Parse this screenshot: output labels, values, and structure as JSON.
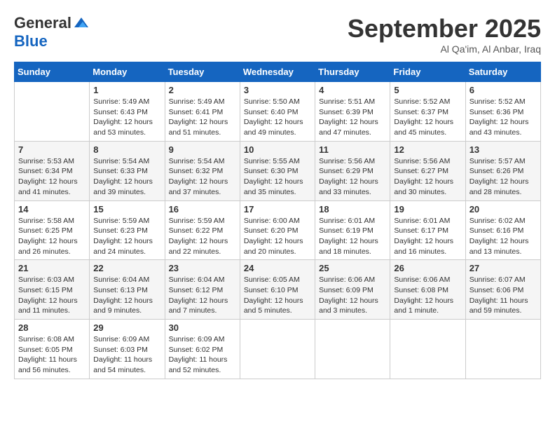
{
  "logo": {
    "general": "General",
    "blue": "Blue"
  },
  "title": "September 2025",
  "location": "Al Qa'im, Al Anbar, Iraq",
  "weekdays": [
    "Sunday",
    "Monday",
    "Tuesday",
    "Wednesday",
    "Thursday",
    "Friday",
    "Saturday"
  ],
  "weeks": [
    [
      {
        "day": "",
        "info": ""
      },
      {
        "day": "1",
        "info": "Sunrise: 5:49 AM\nSunset: 6:43 PM\nDaylight: 12 hours\nand 53 minutes."
      },
      {
        "day": "2",
        "info": "Sunrise: 5:49 AM\nSunset: 6:41 PM\nDaylight: 12 hours\nand 51 minutes."
      },
      {
        "day": "3",
        "info": "Sunrise: 5:50 AM\nSunset: 6:40 PM\nDaylight: 12 hours\nand 49 minutes."
      },
      {
        "day": "4",
        "info": "Sunrise: 5:51 AM\nSunset: 6:39 PM\nDaylight: 12 hours\nand 47 minutes."
      },
      {
        "day": "5",
        "info": "Sunrise: 5:52 AM\nSunset: 6:37 PM\nDaylight: 12 hours\nand 45 minutes."
      },
      {
        "day": "6",
        "info": "Sunrise: 5:52 AM\nSunset: 6:36 PM\nDaylight: 12 hours\nand 43 minutes."
      }
    ],
    [
      {
        "day": "7",
        "info": "Sunrise: 5:53 AM\nSunset: 6:34 PM\nDaylight: 12 hours\nand 41 minutes."
      },
      {
        "day": "8",
        "info": "Sunrise: 5:54 AM\nSunset: 6:33 PM\nDaylight: 12 hours\nand 39 minutes."
      },
      {
        "day": "9",
        "info": "Sunrise: 5:54 AM\nSunset: 6:32 PM\nDaylight: 12 hours\nand 37 minutes."
      },
      {
        "day": "10",
        "info": "Sunrise: 5:55 AM\nSunset: 6:30 PM\nDaylight: 12 hours\nand 35 minutes."
      },
      {
        "day": "11",
        "info": "Sunrise: 5:56 AM\nSunset: 6:29 PM\nDaylight: 12 hours\nand 33 minutes."
      },
      {
        "day": "12",
        "info": "Sunrise: 5:56 AM\nSunset: 6:27 PM\nDaylight: 12 hours\nand 30 minutes."
      },
      {
        "day": "13",
        "info": "Sunrise: 5:57 AM\nSunset: 6:26 PM\nDaylight: 12 hours\nand 28 minutes."
      }
    ],
    [
      {
        "day": "14",
        "info": "Sunrise: 5:58 AM\nSunset: 6:25 PM\nDaylight: 12 hours\nand 26 minutes."
      },
      {
        "day": "15",
        "info": "Sunrise: 5:59 AM\nSunset: 6:23 PM\nDaylight: 12 hours\nand 24 minutes."
      },
      {
        "day": "16",
        "info": "Sunrise: 5:59 AM\nSunset: 6:22 PM\nDaylight: 12 hours\nand 22 minutes."
      },
      {
        "day": "17",
        "info": "Sunrise: 6:00 AM\nSunset: 6:20 PM\nDaylight: 12 hours\nand 20 minutes."
      },
      {
        "day": "18",
        "info": "Sunrise: 6:01 AM\nSunset: 6:19 PM\nDaylight: 12 hours\nand 18 minutes."
      },
      {
        "day": "19",
        "info": "Sunrise: 6:01 AM\nSunset: 6:17 PM\nDaylight: 12 hours\nand 16 minutes."
      },
      {
        "day": "20",
        "info": "Sunrise: 6:02 AM\nSunset: 6:16 PM\nDaylight: 12 hours\nand 13 minutes."
      }
    ],
    [
      {
        "day": "21",
        "info": "Sunrise: 6:03 AM\nSunset: 6:15 PM\nDaylight: 12 hours\nand 11 minutes."
      },
      {
        "day": "22",
        "info": "Sunrise: 6:04 AM\nSunset: 6:13 PM\nDaylight: 12 hours\nand 9 minutes."
      },
      {
        "day": "23",
        "info": "Sunrise: 6:04 AM\nSunset: 6:12 PM\nDaylight: 12 hours\nand 7 minutes."
      },
      {
        "day": "24",
        "info": "Sunrise: 6:05 AM\nSunset: 6:10 PM\nDaylight: 12 hours\nand 5 minutes."
      },
      {
        "day": "25",
        "info": "Sunrise: 6:06 AM\nSunset: 6:09 PM\nDaylight: 12 hours\nand 3 minutes."
      },
      {
        "day": "26",
        "info": "Sunrise: 6:06 AM\nSunset: 6:08 PM\nDaylight: 12 hours\nand 1 minute."
      },
      {
        "day": "27",
        "info": "Sunrise: 6:07 AM\nSunset: 6:06 PM\nDaylight: 11 hours\nand 59 minutes."
      }
    ],
    [
      {
        "day": "28",
        "info": "Sunrise: 6:08 AM\nSunset: 6:05 PM\nDaylight: 11 hours\nand 56 minutes."
      },
      {
        "day": "29",
        "info": "Sunrise: 6:09 AM\nSunset: 6:03 PM\nDaylight: 11 hours\nand 54 minutes."
      },
      {
        "day": "30",
        "info": "Sunrise: 6:09 AM\nSunset: 6:02 PM\nDaylight: 11 hours\nand 52 minutes."
      },
      {
        "day": "",
        "info": ""
      },
      {
        "day": "",
        "info": ""
      },
      {
        "day": "",
        "info": ""
      },
      {
        "day": "",
        "info": ""
      }
    ]
  ]
}
